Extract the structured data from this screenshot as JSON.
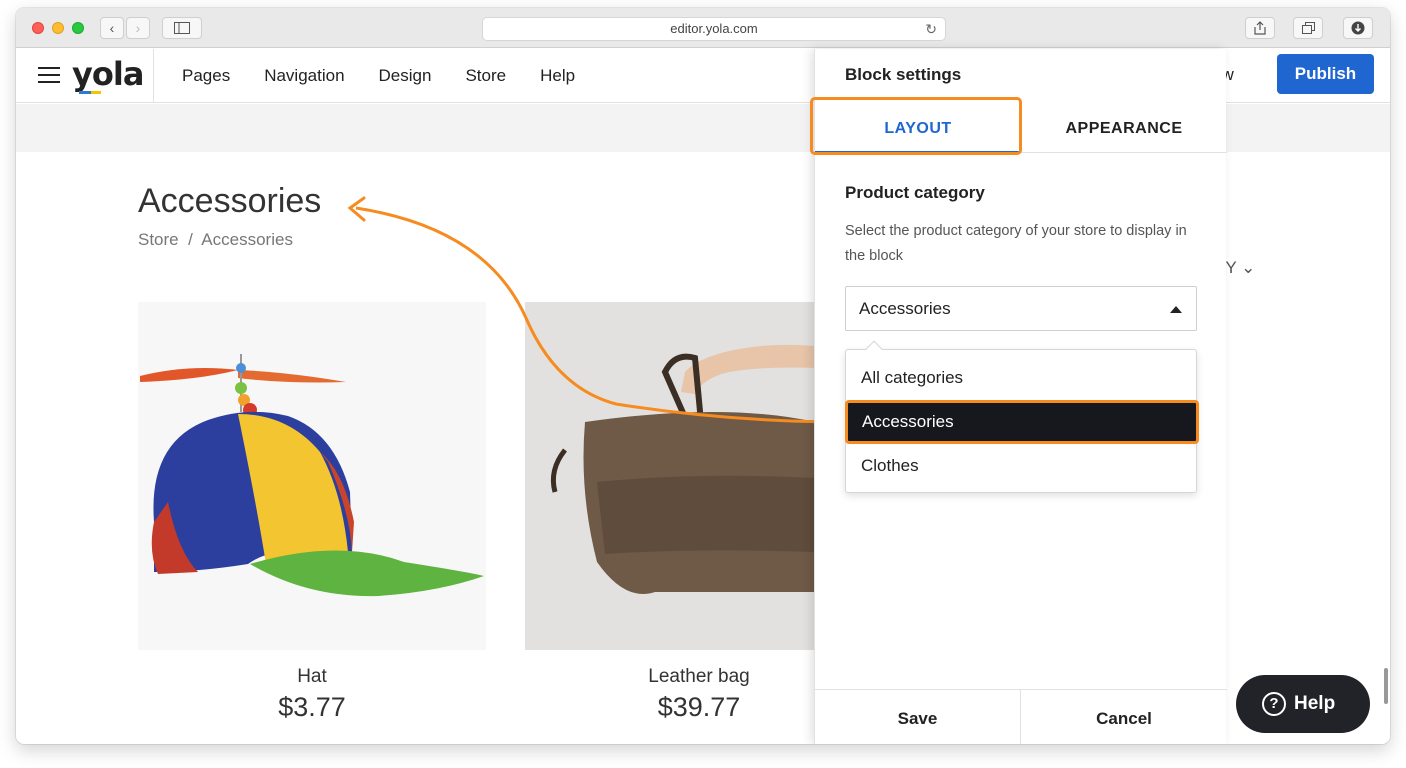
{
  "browser": {
    "url": "editor.yola.com"
  },
  "header": {
    "logo": "yola",
    "nav": [
      "Pages",
      "Navigation",
      "Design",
      "Store",
      "Help"
    ],
    "preview_fragment": "ew",
    "publish_label": "Publish"
  },
  "page": {
    "title": "Accessories",
    "breadcrumb": "Store  /  Accessories",
    "sort_fragment": "BY",
    "products": [
      {
        "name": "Hat",
        "price": "$3.77"
      },
      {
        "name": "Leather bag",
        "price": "$39.77"
      }
    ]
  },
  "panel": {
    "title": "Block settings",
    "tabs": [
      "LAYOUT",
      "APPEARANCE"
    ],
    "active_tab": "LAYOUT",
    "section_title": "Product category",
    "section_desc": "Select the product category of your store to display in the block",
    "selected": "Accessories",
    "options": [
      "All categories",
      "Accessories",
      "Clothes"
    ],
    "save_label": "Save",
    "cancel_label": "Cancel"
  },
  "help_label": "Help",
  "colors": {
    "accent": "#1f66d1",
    "highlight": "#f68b1f",
    "selected_bg": "#16181d"
  }
}
